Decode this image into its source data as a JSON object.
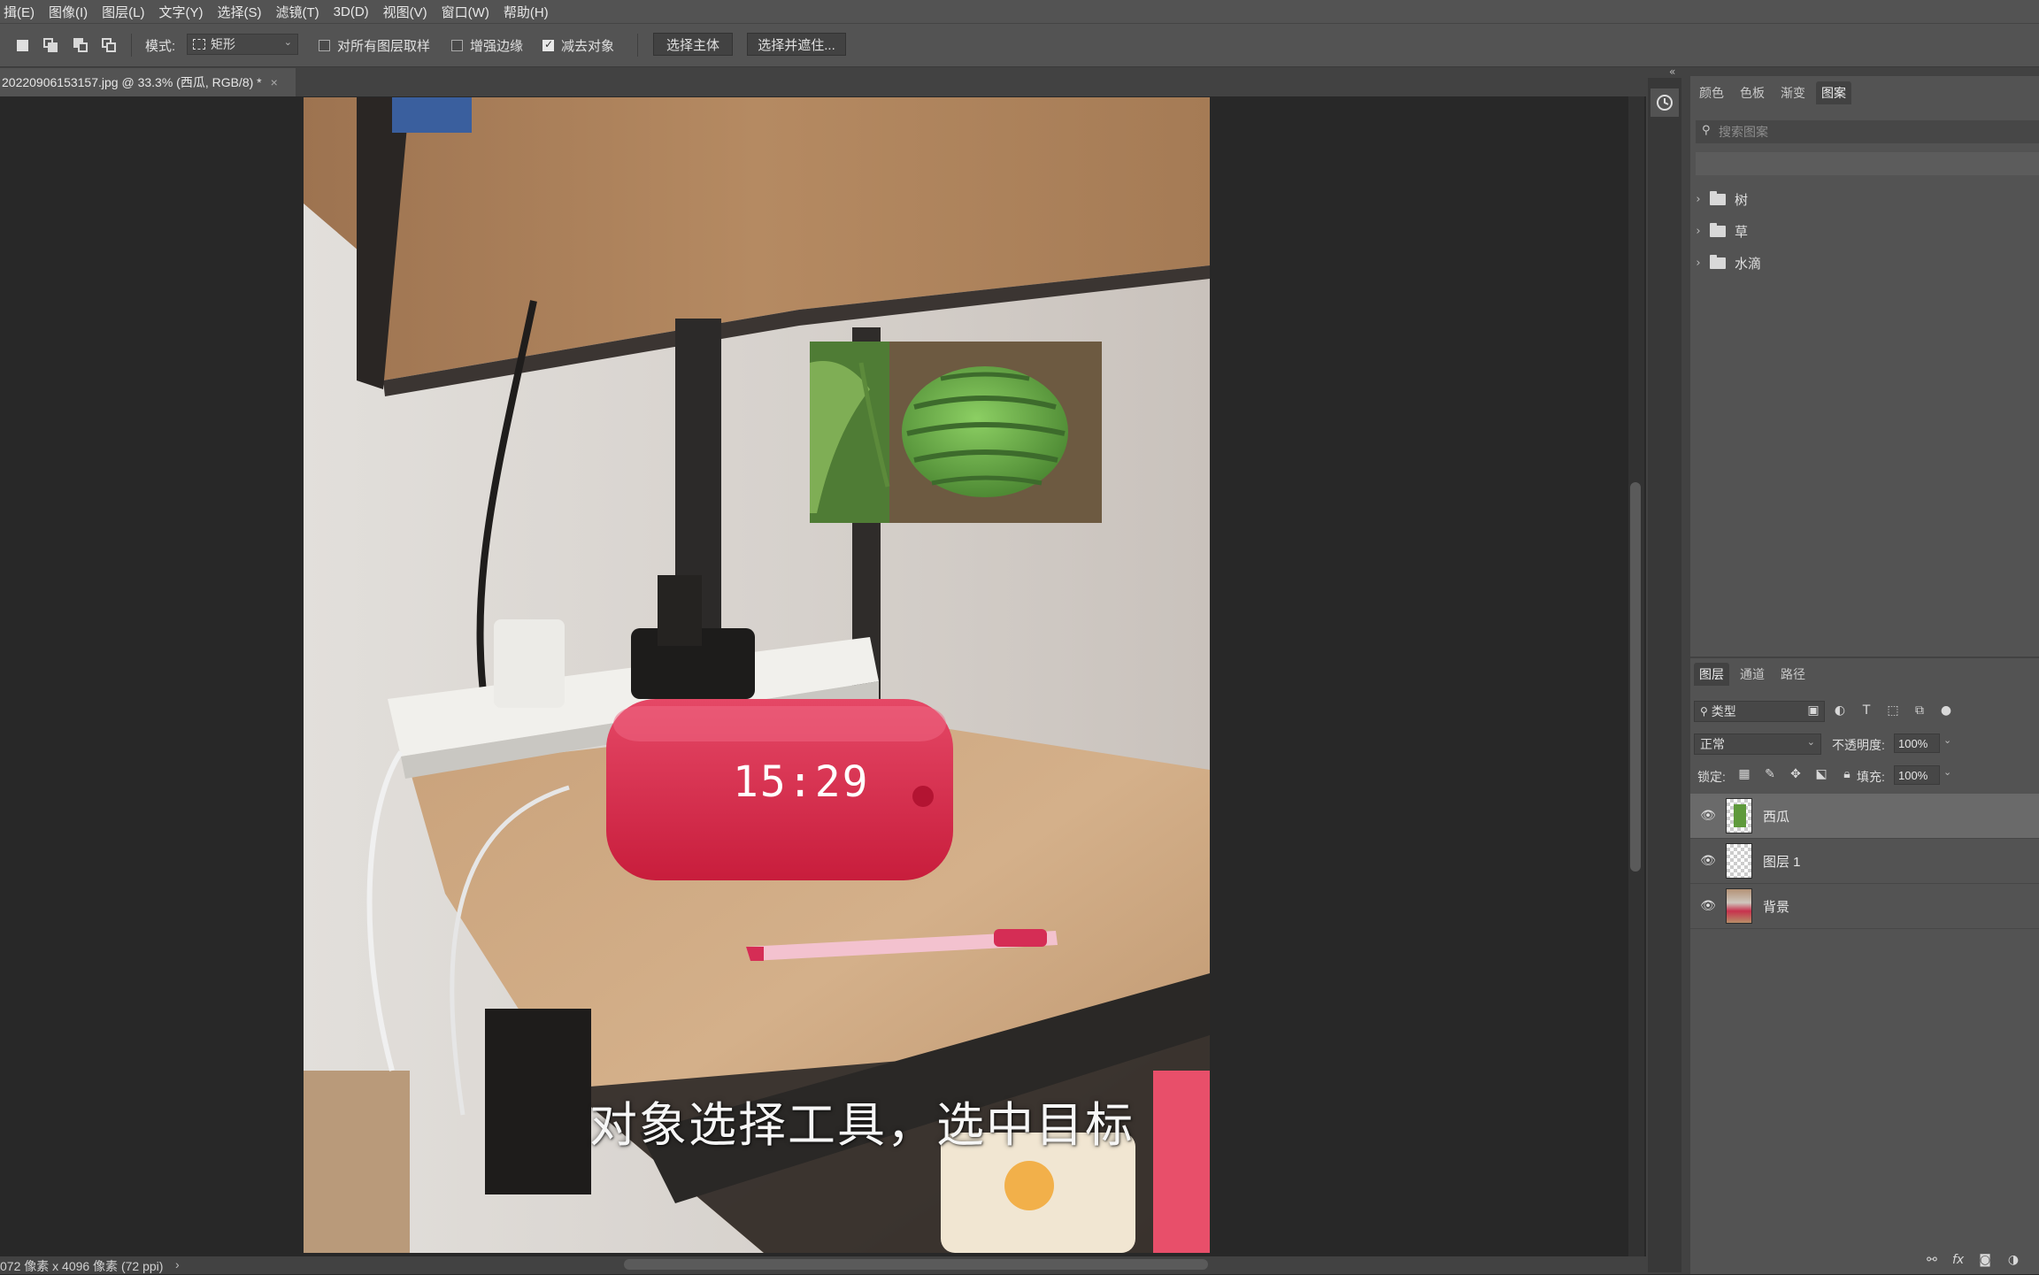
{
  "menu": {
    "items": [
      "揖(E)",
      "图像(I)",
      "图层(L)",
      "文字(Y)",
      "选择(S)",
      "滤镜(T)",
      "3D(D)",
      "视图(V)",
      "窗口(W)",
      "帮助(H)"
    ]
  },
  "options": {
    "mode_label": "模式:",
    "mode_value": "矩形",
    "sample_all_layers": "对所有图层取样",
    "enhance_edge": "增强边缘",
    "subtract_object": "减去对象",
    "select_subject": "选择主体",
    "select_and_mask": "选择并遮住..."
  },
  "document": {
    "tab_title": "20220906153157.jpg @ 33.3% (西瓜, RGB/8) *",
    "close": "×",
    "status": "072 像素 x 4096 像素 (72 ppi)",
    "status_arrow": "›",
    "caption": "对象选择工具，选中目标",
    "clock_display": "15:29"
  },
  "top_panel": {
    "tabs": [
      "颜色",
      "色板",
      "渐变",
      "图案"
    ],
    "active_tab": "图案",
    "search_placeholder": "搜索图案",
    "folders": [
      "树",
      "草",
      "水滴"
    ]
  },
  "layers_panel": {
    "tabs": [
      "图层",
      "通道",
      "路径"
    ],
    "kind_filter": "类型",
    "blend_mode": "正常",
    "opacity_label": "不透明度:",
    "opacity_value": "100%",
    "lock_label": "锁定:",
    "fill_label": "填充:",
    "fill_value": "100%",
    "layers": [
      {
        "name": "西瓜",
        "selected": true
      },
      {
        "name": "图层 1",
        "selected": false
      },
      {
        "name": "背景",
        "selected": false
      }
    ],
    "footer_fx": "fx"
  },
  "colors": {
    "ui_dark": "#282828",
    "ui_panel": "#535353",
    "ui_selected": "#6a6a6a",
    "clock_red": "#d8274a",
    "watermelon_green": "#5f9a3c"
  }
}
